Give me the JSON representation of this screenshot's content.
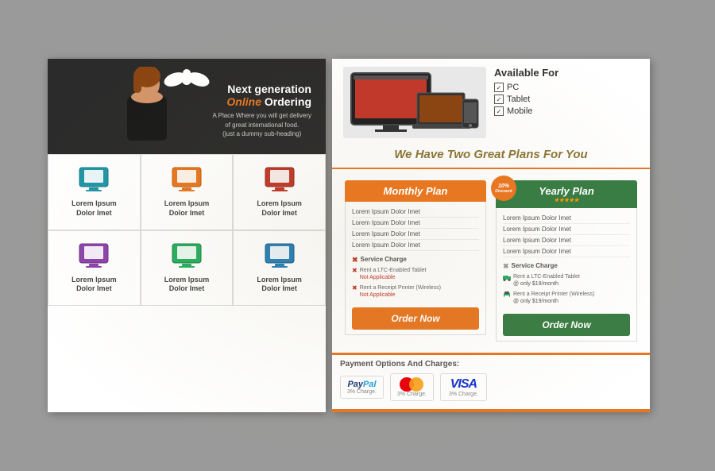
{
  "left": {
    "logo": "🦢",
    "header": {
      "line1": "Next generation",
      "line2_orange": "Online",
      "line2_white": " Ordering",
      "sub": "A Place Where you will get delivery\nof great international food.\n(just a dummy sub-heading)"
    },
    "grid": [
      {
        "label": "Lorem Ipsum\nDolor Imet",
        "color": "#2196a8"
      },
      {
        "label": "Lorem Ipsum\nDolor Imet",
        "color": "#e87722"
      },
      {
        "label": "Lorem Ipsum\nDolor Imet",
        "color": "#c0392b"
      },
      {
        "label": "Lorem Ipsum\nDolor Imet",
        "color": "#8e44ad"
      },
      {
        "label": "Lorem Ipsum\nDolor Imet",
        "color": "#27ae60"
      },
      {
        "label": "Lorem Ipsum\nDolor Imet",
        "color": "#2980b9"
      }
    ]
  },
  "right": {
    "available": {
      "title": "Available For",
      "items": [
        "PC",
        "Tablet",
        "Mobile"
      ]
    },
    "plans_title": "We Have Two Great Plans For You",
    "monthly": {
      "header": "Monthly Plan",
      "items": [
        "Lorem Ipsum Dolor Imet",
        "Lorem Ipsum Dolor Imet",
        "Lorem Ipsum Dolor Imet",
        "Lorem Ipsum Dolor Imet"
      ],
      "service_label": "✖ Service Charge",
      "service1": "Rent a LTC-Enabled Tablet\nNot Applicable",
      "service2": "Rent a Receipt Printer (Wireless)\nNot Applicable",
      "btn": "Order Now"
    },
    "yearly": {
      "header": "Yearly Plan",
      "discount": "10%\nDiscount",
      "stars": "★★★★★",
      "items": [
        "Lorem Ipsum Dolor Imet",
        "Lorem Ipsum Dolor Imet",
        "Lorem Ipsum Dolor Imet",
        "Lorem Ipsum Dolor Imet"
      ],
      "service_label": "✖ Service Charge",
      "service1": "Rent a LTC-Enabled Tablet\n@ only $19/month",
      "service2": "Rent a Receipt Printer (Wireless)\n@ only $19/month",
      "btn": "Order Now"
    },
    "payment": {
      "title": "Payment Options And Charges:",
      "paypal_charge": "3% Charge.",
      "mastercard_charge": "3% Charge.",
      "visa_charge": "3% Charge."
    }
  }
}
